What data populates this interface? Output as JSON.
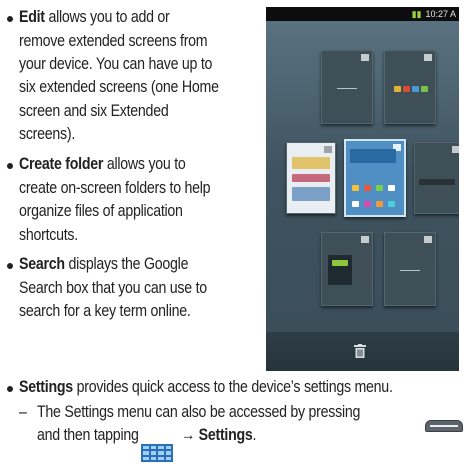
{
  "bullets": {
    "edit": {
      "term": "Edit",
      "lines": [
        " allows you to add or",
        "remove extended screens from",
        "your device. You can have up to",
        "six extended screens (one Home",
        "screen and six Extended",
        "screens)."
      ]
    },
    "create_folder": {
      "term": "Create folder",
      "lines": [
        " allows you to",
        "create on-screen folders to help",
        "organize files of application",
        "shortcuts."
      ]
    },
    "search": {
      "term": "Search",
      "lines": [
        " displays the Google",
        "Search box that you can use to",
        "search for a key term online."
      ]
    },
    "settings": {
      "term": "Settings",
      "rest": " provides quick access to the device’s settings menu."
    }
  },
  "sub_item": {
    "dash": "–",
    "line1": "The Settings menu can also be accessed by pressing",
    "line2_start": "and then tapping",
    "arrow": "→",
    "settings": "Settings",
    "period": "."
  },
  "phone": {
    "clock": "10:27 A",
    "menu_icon": "menu-key-icon",
    "apps_icon": "apps-grid-icon",
    "trash_icon": "trash-icon"
  }
}
